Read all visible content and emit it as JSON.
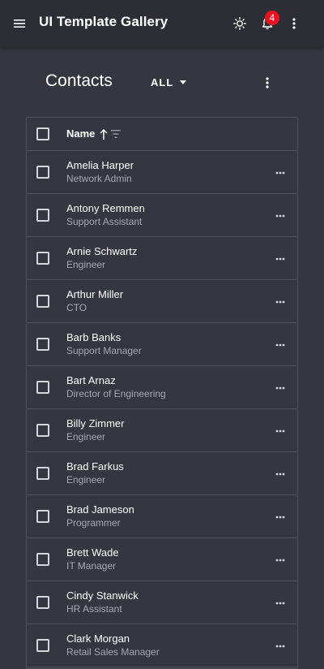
{
  "appbar": {
    "title": "UI Template Gallery",
    "notification_count": "4",
    "badge_color": "#f00f1e",
    "icons": [
      "menu-icon",
      "brightness-icon",
      "bell-icon",
      "more-vert-icon"
    ]
  },
  "page": {
    "title": "Contacts",
    "filter_value": "ALL"
  },
  "table": {
    "column_name": "Name",
    "sort": "ascending",
    "rows": [
      {
        "name": "Amelia Harper",
        "role": "Network Admin"
      },
      {
        "name": "Antony Remmen",
        "role": "Support Assistant"
      },
      {
        "name": "Arnie Schwartz",
        "role": "Engineer"
      },
      {
        "name": "Arthur Miller",
        "role": "CTO"
      },
      {
        "name": "Barb Banks",
        "role": "Support Manager"
      },
      {
        "name": "Bart Arnaz",
        "role": "Director of Engineering"
      },
      {
        "name": "Billy Zimmer",
        "role": "Engineer"
      },
      {
        "name": "Brad Farkus",
        "role": "Engineer"
      },
      {
        "name": "Brad Jameson",
        "role": "Programmer"
      },
      {
        "name": "Brett Wade",
        "role": "IT Manager"
      },
      {
        "name": "Cindy Stanwick",
        "role": "HR Assistant"
      },
      {
        "name": "Clark Morgan",
        "role": "Retail Sales Manager"
      }
    ]
  }
}
